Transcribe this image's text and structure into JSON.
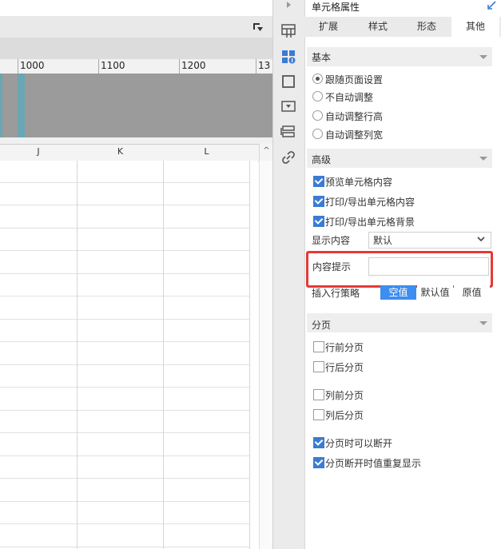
{
  "ruler": {
    "labels": [
      "1000",
      "1100",
      "1200",
      "13"
    ]
  },
  "sheet": {
    "columns": [
      "J",
      "K",
      "L"
    ]
  },
  "panel": {
    "title": "单元格属性",
    "tabs": [
      {
        "label": "扩展",
        "active": false
      },
      {
        "label": "样式",
        "active": false
      },
      {
        "label": "形态",
        "active": false
      },
      {
        "label": "其他",
        "active": true
      }
    ],
    "basic": {
      "title": "基本",
      "options": [
        {
          "label": "跟随页面设置",
          "selected": true
        },
        {
          "label": "不自动调整",
          "selected": false
        },
        {
          "label": "自动调整行高",
          "selected": false
        },
        {
          "label": "自动调整列宽",
          "selected": false
        }
      ]
    },
    "advanced": {
      "title": "高级",
      "checks": [
        {
          "label": "预览单元格内容",
          "checked": true
        },
        {
          "label": "打印/导出单元格内容",
          "checked": true
        },
        {
          "label": "打印/导出单元格背景",
          "checked": true
        }
      ],
      "display_label": "显示内容",
      "display_value": "默认",
      "hint_label": "内容提示",
      "hint_value": "",
      "insert_label": "插入行策略",
      "insert_options": [
        {
          "label": "空值",
          "active": true
        },
        {
          "label": "默认值",
          "active": false
        },
        {
          "label": "原值",
          "active": false
        }
      ]
    },
    "paging": {
      "title": "分页",
      "checks": [
        {
          "label": "行前分页",
          "checked": false
        },
        {
          "label": "行后分页",
          "checked": false
        },
        {
          "label": "列前分页",
          "checked": false
        },
        {
          "label": "列后分页",
          "checked": false
        },
        {
          "label": "分页时可以断开",
          "checked": true
        },
        {
          "label": "分页断开时值重复显示",
          "checked": true
        }
      ]
    }
  },
  "icons": [
    "collapse-arrow-icon",
    "cell-expand-icon",
    "cell-attributes-icon",
    "border-icon",
    "widget-icon",
    "form-icon",
    "link-icon",
    "pin-icon",
    "dropdown-icon"
  ],
  "colors": {
    "accent": "#3d8ef0",
    "highlight": "#e53a36",
    "checkbox": "#3b7cd3"
  }
}
